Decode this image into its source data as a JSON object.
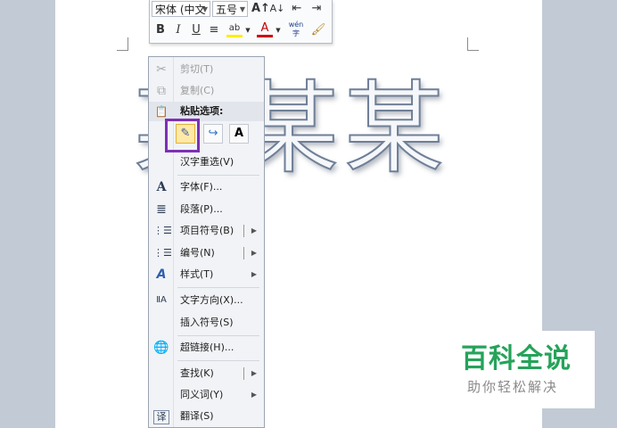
{
  "document": {
    "wordart_text": "某某某"
  },
  "mini_toolbar": {
    "font_name": "宋体 (中文",
    "font_size": "五号",
    "grow_font_icon": "A↑",
    "shrink_font_icon": "A↓",
    "bold": "B",
    "italic": "I",
    "underline": "U",
    "center": "≡",
    "font_color": "A",
    "phonetic": "wén"
  },
  "context_menu": {
    "items": [
      {
        "label": "剪切(T)",
        "icon": "scissors-icon",
        "glyph": "✂"
      },
      {
        "label": "复制(C)",
        "icon": "copy-icon",
        "glyph": "⧉"
      },
      {
        "label": "粘贴选项:",
        "icon": "clipboard-icon",
        "glyph": "📋"
      },
      {
        "label": "汉字重选(V)",
        "icon": "",
        "glyph": ""
      },
      {
        "label": "字体(F)...",
        "icon": "font-icon",
        "glyph": "A"
      },
      {
        "label": "段落(P)...",
        "icon": "paragraph-icon",
        "glyph": "≣"
      },
      {
        "label": "项目符号(B)",
        "icon": "bullets-icon",
        "glyph": "⋮☰"
      },
      {
        "label": "编号(N)",
        "icon": "numbering-icon",
        "glyph": "⋮☰"
      },
      {
        "label": "样式(T)",
        "icon": "styles-icon",
        "glyph": "A"
      },
      {
        "label": "文字方向(X)...",
        "icon": "text-direction-icon",
        "glyph": "ⅡA"
      },
      {
        "label": "插入符号(S)",
        "icon": "",
        "glyph": ""
      },
      {
        "label": "超链接(H)...",
        "icon": "hyperlink-icon",
        "glyph": "🌐"
      },
      {
        "label": "查找(K)",
        "icon": "",
        "glyph": ""
      },
      {
        "label": "同义词(Y)",
        "icon": "",
        "glyph": ""
      },
      {
        "label": "翻译(S)",
        "icon": "translate-icon",
        "glyph": "译"
      }
    ],
    "paste_options": [
      {
        "name": "keep-source-formatting",
        "glyph": "✎"
      },
      {
        "name": "merge-formatting",
        "glyph": "↪"
      },
      {
        "name": "keep-text-only",
        "glyph": "A"
      }
    ]
  },
  "watermark": {
    "title": "百科全说",
    "subtitle": "助你轻松解决"
  },
  "colors": {
    "highlight_box": "#7d2fb5",
    "watermark_green": "#25a35a"
  }
}
